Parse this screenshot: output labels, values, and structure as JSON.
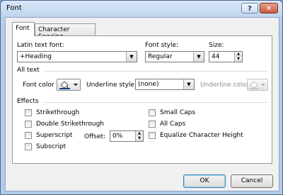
{
  "window": {
    "title": "Font",
    "help_label": "?",
    "close_label": "✕"
  },
  "tabs": [
    {
      "label": "Font",
      "active": true
    },
    {
      "label": "Character Spacing",
      "active": false
    }
  ],
  "latin_font": {
    "label": "Latin text font:",
    "value": "+Heading"
  },
  "font_style": {
    "label": "Font style:",
    "value": "Regular"
  },
  "size": {
    "label": "Size:",
    "value": "44"
  },
  "all_text": {
    "section_label": "All text",
    "font_color_label": "Font color",
    "underline_style_label": "Underline style",
    "underline_style_value": "(none)",
    "underline_color_label": "Underline color",
    "font_color_swatch": "#1f3f8c"
  },
  "effects": {
    "section_label": "Effects",
    "left": [
      "Strikethrough",
      "Double Strikethrough",
      "Superscript",
      "Subscript"
    ],
    "right": [
      "Small Caps",
      "All Caps",
      "Equalize Character Height"
    ],
    "offset_label": "Offset:",
    "offset_value": "0%"
  },
  "buttons": {
    "ok": "OK",
    "cancel": "Cancel"
  }
}
